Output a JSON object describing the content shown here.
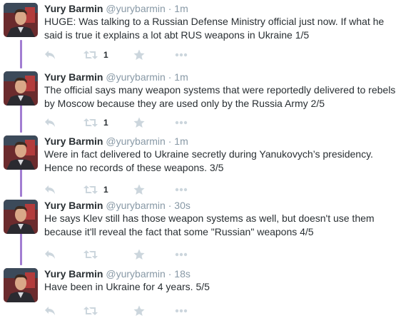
{
  "tweets": [
    {
      "name": "Yury Barmin",
      "handle": "@yurybarmin",
      "separator": "·",
      "time": "1m",
      "text": "HUGE: Was talking to a Russian Defense Ministry official just now. If what he said is true it explains a lot abt RUS weapons in Ukraine 1/5",
      "retweets": "1"
    },
    {
      "name": "Yury Barmin",
      "handle": "@yurybarmin",
      "separator": "·",
      "time": "1m",
      "text": "The official says many weapon systems that were reportedly delivered to rebels by Moscow because they are used only by the Russia Army 2/5",
      "retweets": "1"
    },
    {
      "name": "Yury Barmin",
      "handle": "@yurybarmin",
      "separator": "·",
      "time": "1m",
      "text": "Were in fact delivered to Ukraine secretly during Yanukovych’s presidency. Hence no records of these weapons. 3/5",
      "retweets": "1"
    },
    {
      "name": "Yury Barmin",
      "handle": "@yurybarmin",
      "separator": "·",
      "time": "30s",
      "text": "He says Klev still has those weapon systems as well, but doesn't use them because it'll reveal the fact that some \"Russian\" weapons 4/5",
      "retweets": ""
    },
    {
      "name": "Yury Barmin",
      "handle": "@yurybarmin",
      "separator": "·",
      "time": "18s",
      "text": "Have been in Ukraine for 4 years. 5/5",
      "retweets": ""
    }
  ],
  "icons": {
    "reply": "reply-icon",
    "retweet": "retweet-icon",
    "favorite": "star-icon",
    "more": "more-icon"
  },
  "colors": {
    "thread_line": "#a27dd2",
    "action_icon": "#ccd6dd",
    "secondary_text": "#8899a6"
  }
}
